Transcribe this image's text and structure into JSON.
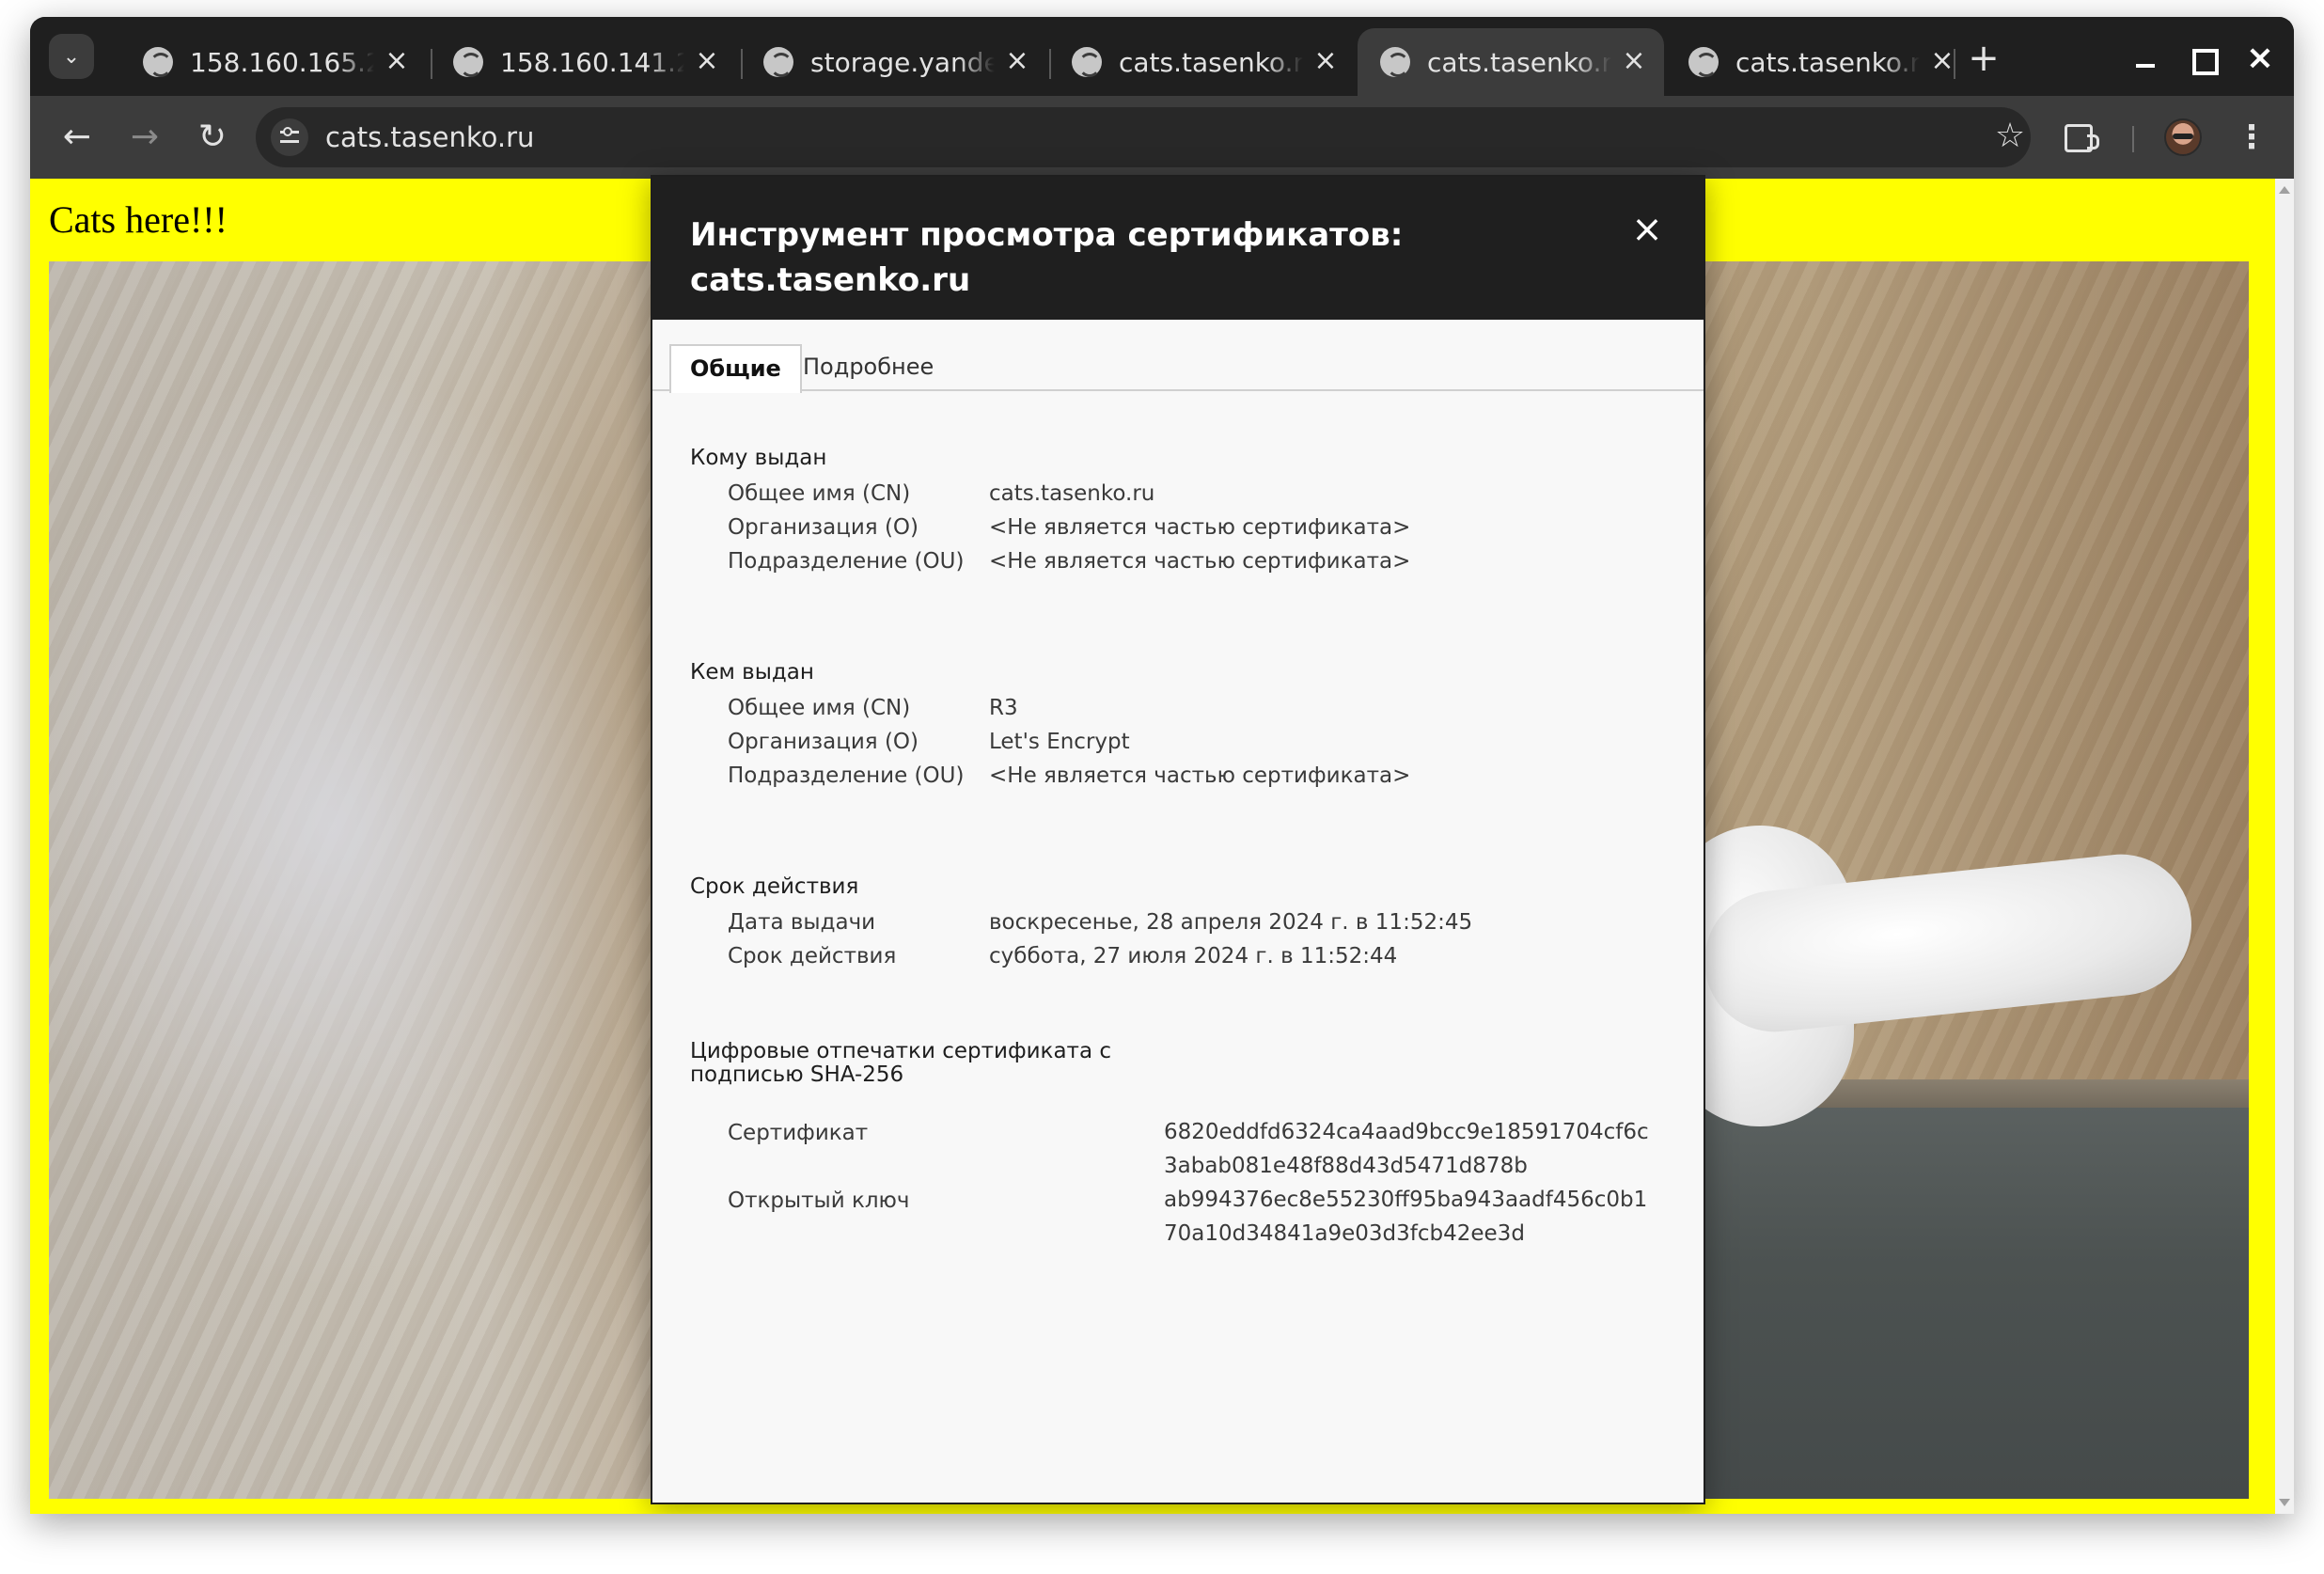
{
  "browser": {
    "tabs": [
      {
        "title": "158.160.165.2",
        "active": false
      },
      {
        "title": "158.160.141.2",
        "active": false
      },
      {
        "title": "storage.yande",
        "active": false
      },
      {
        "title": "cats.tasenko.r",
        "active": false
      },
      {
        "title": "cats.tasenko.r",
        "active": true
      },
      {
        "title": "cats.tasenko.r",
        "active": false
      }
    ],
    "new_tab_symbol": "+",
    "address": "cats.tasenko.ru",
    "icons": {
      "tab_search": "chevron-down-icon",
      "back": "arrow-left-icon",
      "forward": "arrow-right-icon",
      "reload": "reload-icon",
      "site_info": "tune-icon",
      "bookmark": "star-icon",
      "extensions": "puzzle-icon",
      "menu": "kebab-menu-icon"
    }
  },
  "page": {
    "heading": "Cats here!!!",
    "background_color": "#ffff00"
  },
  "dialog": {
    "title": "Инструмент просмотра сертификатов: cats.tasenko.ru",
    "tabs": [
      "Общие",
      "Подробнее"
    ],
    "active_tab": "Общие",
    "issued_to": {
      "title": "Кому выдан",
      "rows": [
        {
          "label": "Общее имя (CN)",
          "value": "cats.tasenko.ru"
        },
        {
          "label": "Организация (O)",
          "value": "<Не является частью сертификата>"
        },
        {
          "label": "Подразделение (OU)",
          "value": "<Не является частью сертификата>"
        }
      ]
    },
    "issued_by": {
      "title": "Кем выдан",
      "rows": [
        {
          "label": "Общее имя (CN)",
          "value": "R3"
        },
        {
          "label": "Организация (O)",
          "value": "Let's Encrypt"
        },
        {
          "label": "Подразделение (OU)",
          "value": "<Не является частью сертификата>"
        }
      ]
    },
    "validity": {
      "title": "Срок действия",
      "rows": [
        {
          "label": "Дата выдачи",
          "value": "воскресенье, 28 апреля 2024 г. в 11:52:45"
        },
        {
          "label": "Срок действия",
          "value": "суббота, 27 июля 2024 г. в 11:52:44"
        }
      ]
    },
    "fingerprints": {
      "title": "Цифровые отпечатки сертификата с подписью SHA-256",
      "rows": [
        {
          "label": "Сертификат",
          "value": "6820eddfd6324ca4aad9bcc9e18591704cf6c3abab081e48f88d43d5471d878b"
        },
        {
          "label": "Открытый ключ",
          "value": "ab994376ec8e55230ff95ba943aadf456c0b170a10d34841a9e03d3fcb42ee3d"
        }
      ]
    }
  }
}
